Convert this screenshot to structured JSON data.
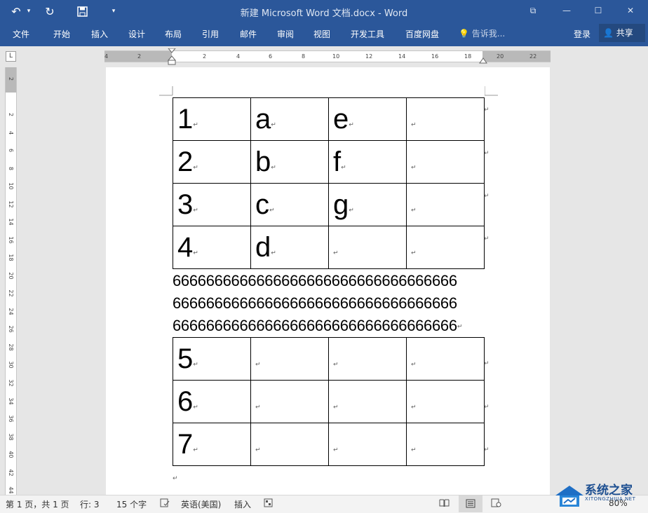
{
  "window": {
    "title": "新建 Microsoft Word 文档.docx - Word",
    "quick_access": {
      "undo": "↶",
      "undo_dropdown": "▾",
      "redo": "↻",
      "save": "💾",
      "customize": "▾"
    },
    "controls": {
      "restore_ribbon": "⧉",
      "minimize": "—",
      "maximize": "☐",
      "close": "✕"
    }
  },
  "menu": {
    "tabs": [
      "文件",
      "开始",
      "插入",
      "设计",
      "布局",
      "引用",
      "邮件",
      "审阅",
      "视图",
      "开发工具",
      "百度网盘"
    ],
    "tell_me": "告诉我...",
    "login": "登录",
    "share": "共享"
  },
  "ruler": {
    "corner": "L",
    "h_ticks": [
      "4",
      "2",
      "2",
      "4",
      "6",
      "8",
      "10",
      "12",
      "14",
      "16",
      "18",
      "20",
      "22"
    ],
    "v_ticks": [
      "2",
      "2",
      "4",
      "6",
      "8",
      "10",
      "12",
      "14",
      "16",
      "18",
      "20",
      "22",
      "24",
      "26",
      "28",
      "30",
      "32",
      "34",
      "36",
      "38",
      "40",
      "42",
      "44"
    ]
  },
  "document": {
    "table1": [
      [
        "1",
        "a",
        "e",
        ""
      ],
      [
        "2",
        "b",
        "f",
        ""
      ],
      [
        "3",
        "c",
        "g",
        ""
      ],
      [
        "4",
        "d",
        "",
        ""
      ]
    ],
    "paragraph_lines": [
      "6666666666666666666666666666666666",
      "6666666666666666666666666666666666",
      "6666666666666666666666666666666666"
    ],
    "table2": [
      [
        "5",
        "",
        "",
        ""
      ],
      [
        "6",
        "",
        "",
        ""
      ],
      [
        "7",
        "",
        "",
        ""
      ]
    ],
    "para_mark": "↵"
  },
  "status": {
    "page": "第 1 页，共 1 页",
    "row": "行: 3",
    "words": "15 个字",
    "language": "英语(美国)",
    "mode": "插入",
    "zoom": "80%"
  },
  "watermark": {
    "name": "系统之家",
    "url": "XITONGZHIJIA.NET"
  },
  "colors": {
    "accent": "#2b579a",
    "share_bg": "#24497f"
  }
}
